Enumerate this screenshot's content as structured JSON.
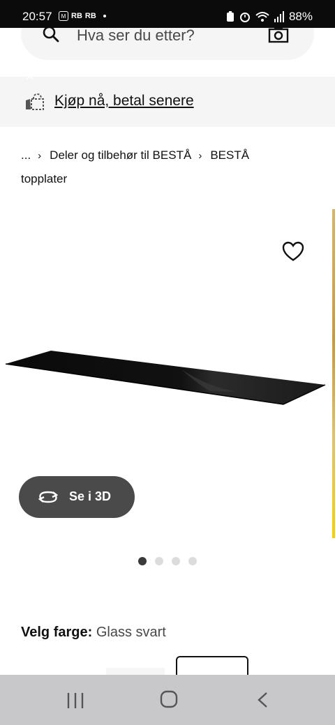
{
  "status_bar": {
    "time": "20:57",
    "notif_badge": "M",
    "notif_text_1": "RB",
    "notif_text_2": "RB",
    "battery": "88%"
  },
  "search": {
    "placeholder": "Hva ser du etter?",
    "search_icon": "search-icon",
    "camera_icon": "camera-icon"
  },
  "banner": {
    "text": "Kjøp nå, betal senere",
    "icon": "shopping-bag-icon"
  },
  "breadcrumb": {
    "ellipsis": "...",
    "item1": "Deler og tilbehør til BESTÅ",
    "item2": "BESTÅ",
    "current": "topplater",
    "separator": "›"
  },
  "product": {
    "image": "black-glass-top-panel",
    "wishlist_icon": "heart-icon"
  },
  "view3d": {
    "label": "Se i 3D",
    "icon": "rotate-3d-icon"
  },
  "carousel": {
    "count": 4,
    "active_index": 0
  },
  "color": {
    "label": "Velg farge:",
    "value": "Glass svart"
  },
  "nav": {
    "recent_icon": "recent-apps-icon",
    "home_icon": "home-icon",
    "back_icon": "back-icon"
  },
  "colors": {
    "accent": "#111111",
    "banner_bg": "#f5f5f5",
    "button_bg": "#4a4a4a",
    "navbar_bg": "#c8c8ca"
  }
}
